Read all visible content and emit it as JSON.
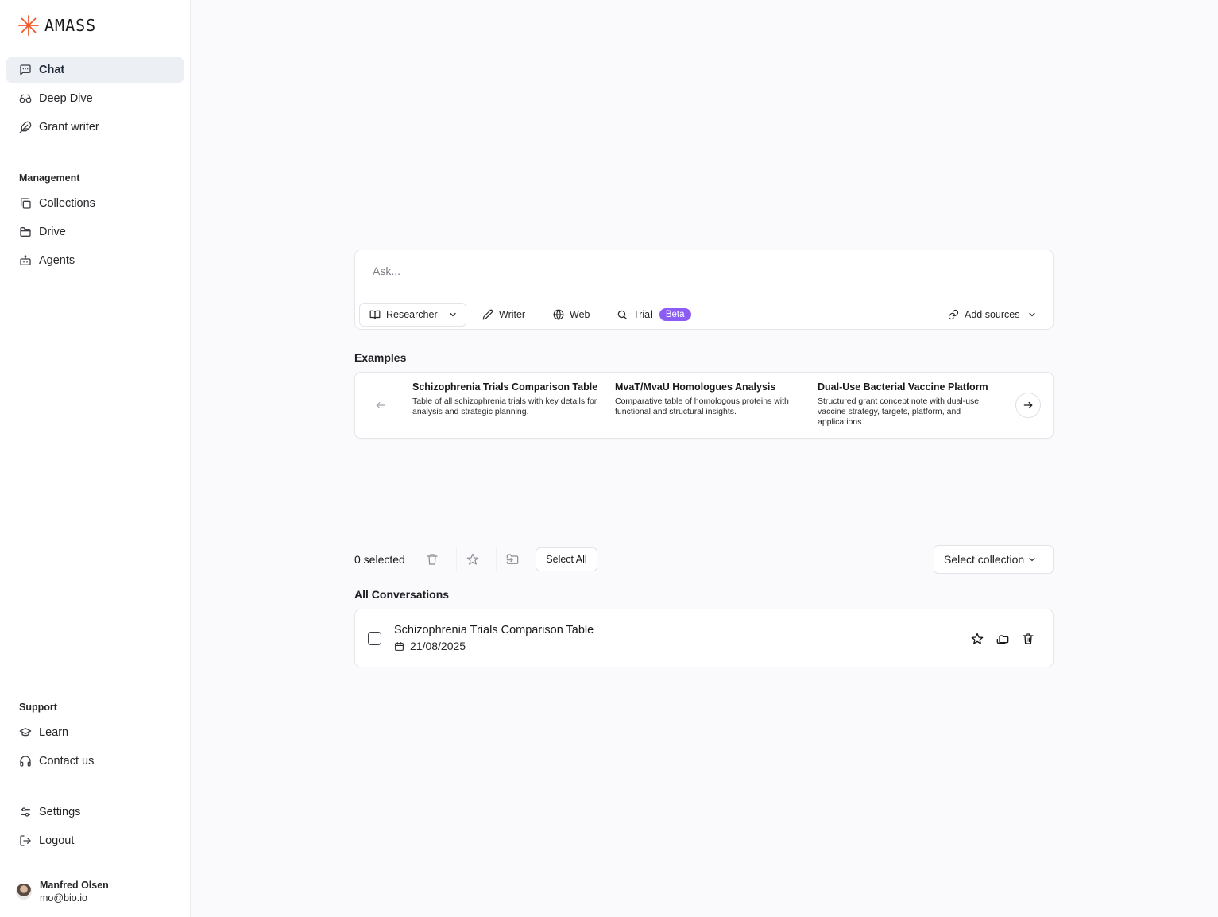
{
  "brand": {
    "name": "AMASS",
    "accent": "#f05a28"
  },
  "sidebar": {
    "primary": [
      {
        "label": "Chat",
        "icon": "message-square-icon",
        "active": true
      },
      {
        "label": "Deep Dive",
        "icon": "glasses-icon"
      },
      {
        "label": "Grant writer",
        "icon": "feather-icon"
      }
    ],
    "management_title": "Management",
    "management": [
      {
        "label": "Collections",
        "icon": "copy-icon"
      },
      {
        "label": "Drive",
        "icon": "folder-icon"
      },
      {
        "label": "Agents",
        "icon": "bot-icon"
      }
    ],
    "support_title": "Support",
    "support": [
      {
        "label": "Learn",
        "icon": "graduation-cap-icon"
      },
      {
        "label": "Contact us",
        "icon": "headphones-icon"
      }
    ],
    "bottom": [
      {
        "label": "Settings",
        "icon": "sliders-icon"
      },
      {
        "label": "Logout",
        "icon": "log-out-icon"
      }
    ],
    "user": {
      "name": "Manfred Olsen",
      "email": "mo@bio.io"
    }
  },
  "ask": {
    "placeholder": "Ask...",
    "researcher_label": "Researcher",
    "writer_label": "Writer",
    "web_label": "Web",
    "trial_label": "Trial",
    "beta_badge": "Beta",
    "beta_color": "#8b5cf6",
    "add_sources_label": "Add sources"
  },
  "examples": {
    "title": "Examples",
    "items": [
      {
        "title": "Schizophrenia Trials Comparison Table",
        "desc": "Table of all schizophrenia trials with key details for analysis and strategic planning."
      },
      {
        "title": "MvaT/MvaU Homologues Analysis",
        "desc": "Comparative table of homologous proteins with functional and structural insights."
      },
      {
        "title": "Dual-Use Bacterial Vaccine Platform",
        "desc": "Structured grant concept note with dual-use vaccine strategy, targets, platform, and applications."
      }
    ]
  },
  "toolbar": {
    "selected_text": "0 selected",
    "select_all_label": "Select All",
    "select_collection_label": "Select collection"
  },
  "conversations": {
    "title": "All Conversations",
    "items": [
      {
        "name": "Schizophrenia Trials Comparison Table",
        "date": "21/08/2025"
      }
    ]
  }
}
